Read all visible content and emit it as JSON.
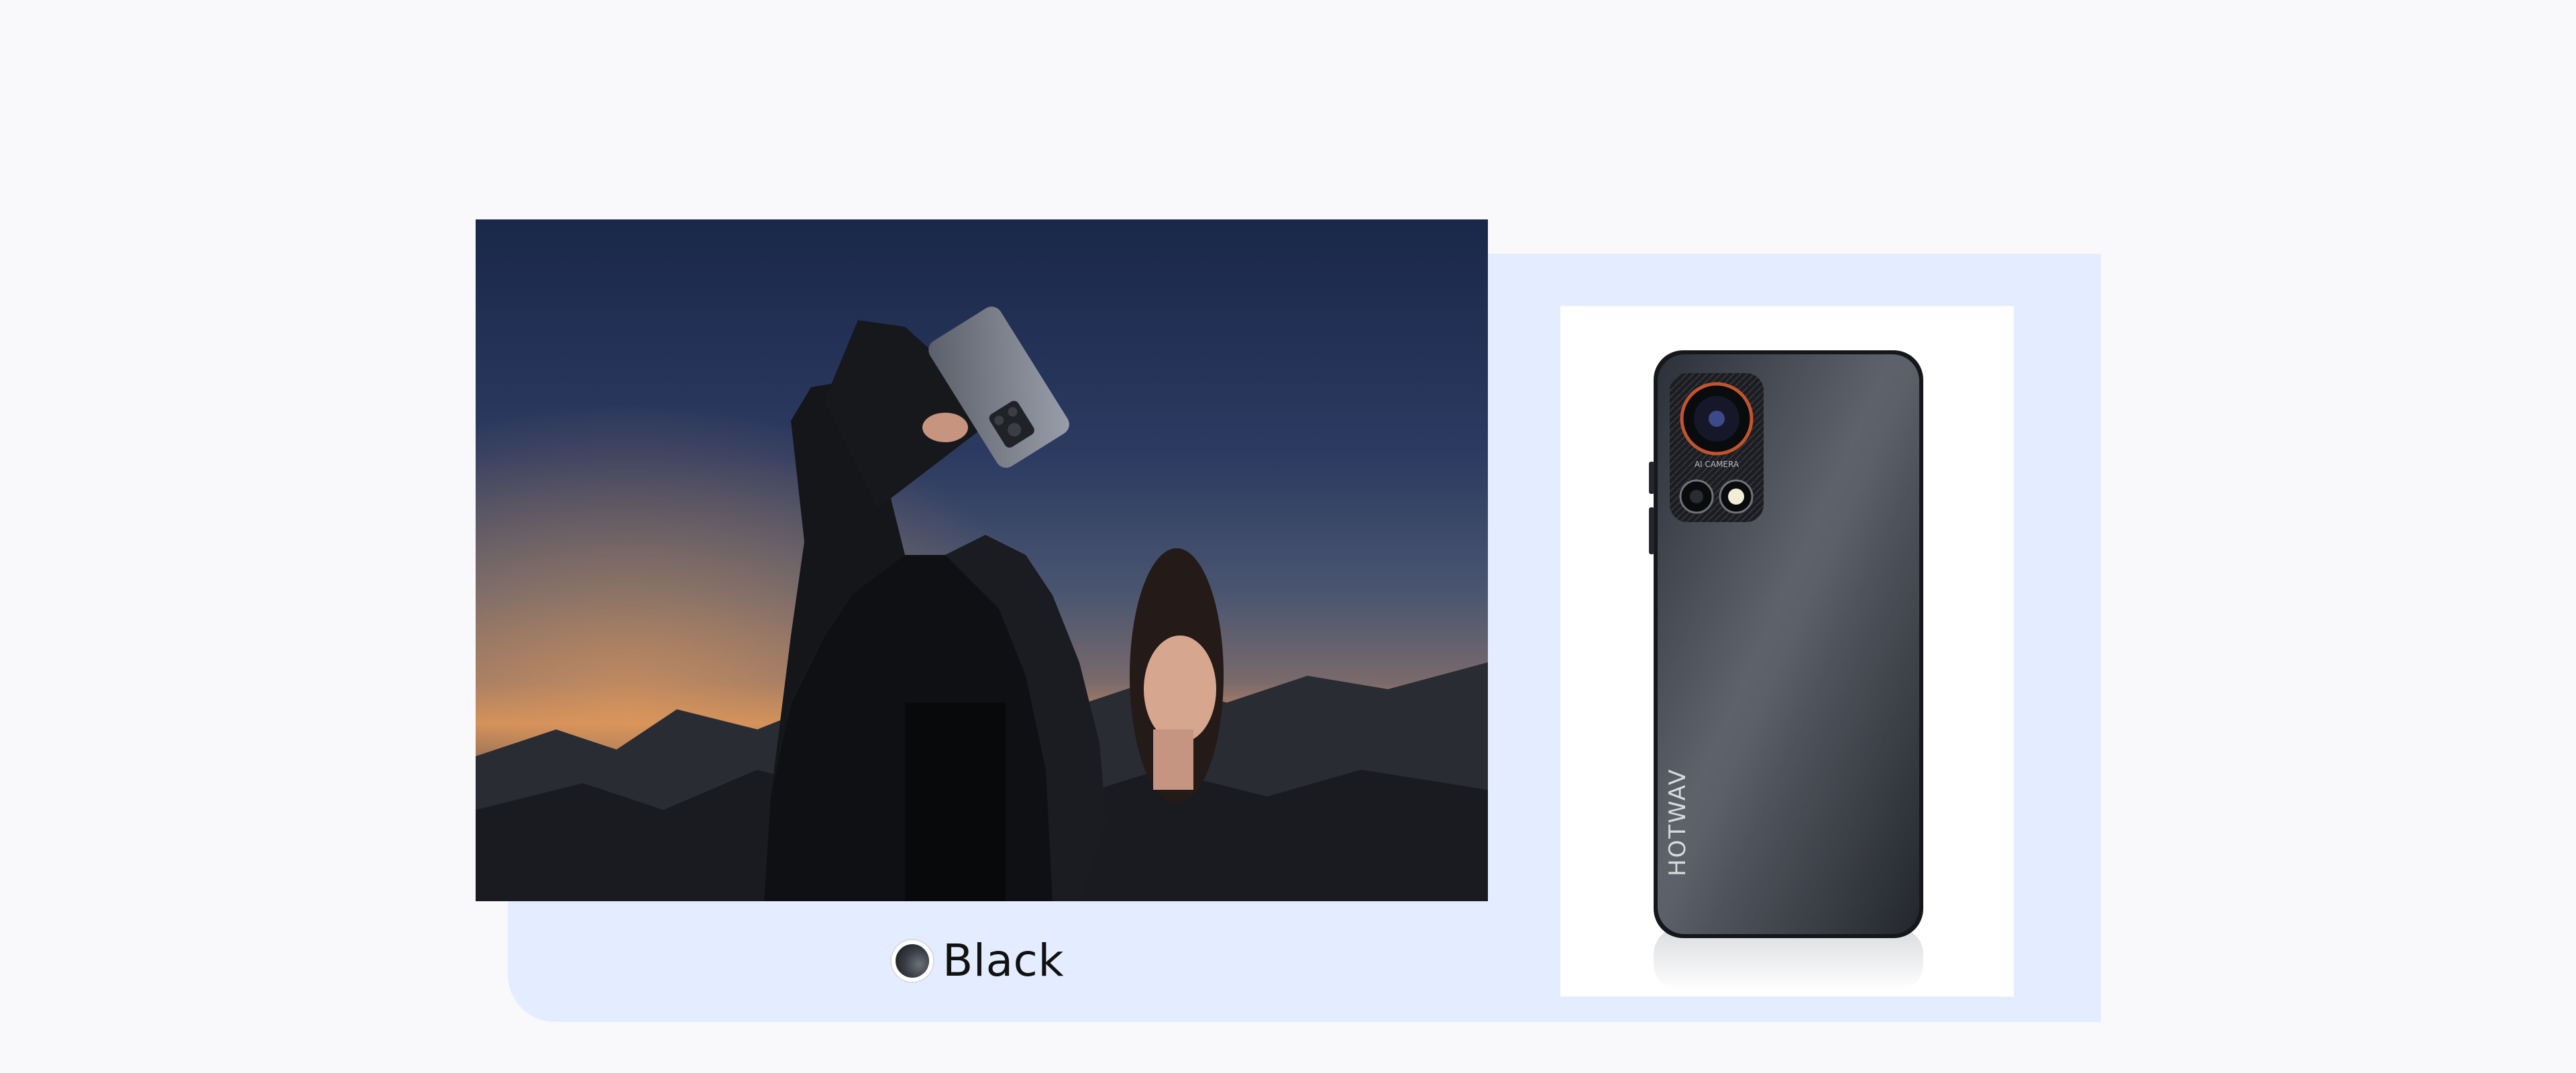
{
  "product": {
    "brand_mark": "HOTWAV",
    "camera_mark": "AI CAMERA"
  },
  "color_selector": {
    "selected_label": "Black",
    "swatch_color": "#2b2e35",
    "accent_panel_color": "#e4edff"
  },
  "images": {
    "lifestyle": "woman-holding-phone-at-dusk",
    "product": "phone-back-view-black"
  }
}
